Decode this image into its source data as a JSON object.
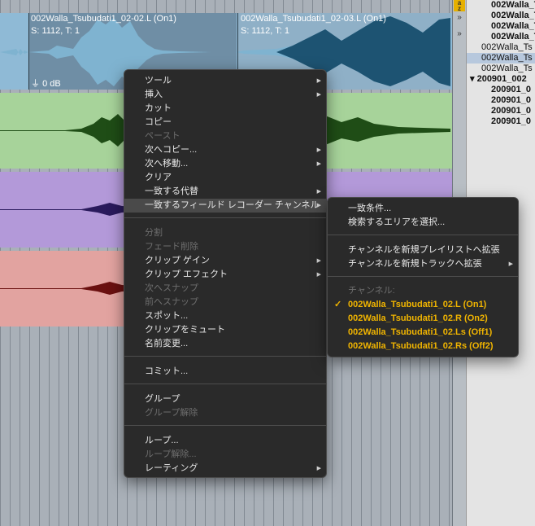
{
  "clips": {
    "clip1": {
      "name": "002Walla_Tsubudati1_02-02.L (On1)",
      "meta": "S: 1112, T: 1",
      "gain": "0 dB"
    },
    "clip2": {
      "name": "002Walla_Tsubudati1_02-03.L (On1)",
      "meta": "S: 1112, T: 1"
    }
  },
  "right_strip": {
    "az_icon": "a-z-sort-icon",
    "buttons": [
      "»",
      "»"
    ]
  },
  "clip_list": {
    "items": [
      "002Walla_T",
      "002Walla_T",
      "002Walla_T",
      "002Walla_T",
      "002Walla_Ts",
      "002Walla_Ts",
      "002Walla_Ts",
      "▾ 200901_002",
      "200901_0",
      "200901_0",
      "200901_0",
      "200901_0"
    ]
  },
  "context_menu": {
    "items": [
      {
        "label": "ツール",
        "submenu": true
      },
      {
        "label": "挿入",
        "submenu": true
      },
      {
        "label": "カット"
      },
      {
        "label": "コピー"
      },
      {
        "label": "ペースト",
        "disabled": true
      },
      {
        "label": "次へコピー...",
        "submenu": true
      },
      {
        "label": "次へ移動...",
        "submenu": true
      },
      {
        "label": "クリア"
      },
      {
        "label": "一致する代替",
        "submenu": true
      },
      {
        "label": "一致するフィールド レコーダー チャンネル",
        "submenu": true,
        "highlighted": true
      },
      {
        "label": "分割",
        "disabled": true
      },
      {
        "label": "フェード削除",
        "disabled": true
      },
      {
        "label": "クリップ ゲイン",
        "submenu": true
      },
      {
        "label": "クリップ エフェクト",
        "submenu": true
      },
      {
        "label": "次へスナップ",
        "disabled": true
      },
      {
        "label": "前へスナップ",
        "disabled": true
      },
      {
        "label": "スポット..."
      },
      {
        "label": "クリップをミュート"
      },
      {
        "label": "名前変更..."
      },
      {
        "label": "コミット..."
      },
      {
        "label": "グループ"
      },
      {
        "label": "グループ解除",
        "disabled": true
      },
      {
        "label": "ループ..."
      },
      {
        "label": "ループ解除...",
        "disabled": true
      },
      {
        "label": "レーティング",
        "submenu": true
      }
    ]
  },
  "submenu": {
    "items": [
      {
        "label": "一致条件..."
      },
      {
        "label": "検索するエリアを選択..."
      },
      {
        "label": "チャンネルを新規プレイリストへ拡張"
      },
      {
        "label": "チャンネルを新規トラックへ拡張",
        "submenu": true
      },
      {
        "label": "チャンネル:",
        "header": true
      },
      {
        "label": "002Walla_Tsubudati1_02.L (On1)",
        "checked": true
      },
      {
        "label": "002Walla_Tsubudati1_02.R (On2)"
      },
      {
        "label": "002Walla_Tsubudati1_02.Ls (Off1)"
      },
      {
        "label": "002Walla_Tsubudati1_02.Rs (Off2)"
      }
    ],
    "check_mark": "✓"
  },
  "colors": {
    "track_blue": "#8fbad6",
    "clip_blue_selected": "#6f8ea5",
    "clip_blue_dark": "#1d5372",
    "track_green": "#a7d39a",
    "wave_green": "#1f4d16",
    "track_purple": "#b399d9",
    "wave_purple": "#2a1a5c",
    "track_red": "#e2a3a0",
    "wave_red": "#6a1010",
    "menu_bg": "#2a2a2a",
    "highlight": "#4a4a4a",
    "accent_orange": "#f0b400"
  }
}
